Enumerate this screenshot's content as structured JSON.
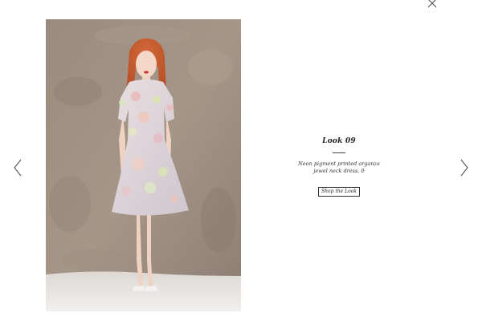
{
  "look": {
    "title": "Look 09",
    "description_line1": "Neon pigment printed organza",
    "description_line2": "jewel neck dress. 0",
    "shop_button": "Shop the Look"
  },
  "icons": {
    "close": "close-icon",
    "previous": "chevron-left-icon",
    "next": "chevron-right-icon"
  },
  "colors": {
    "background": "#ffffff",
    "text": "#222222",
    "icon": "#555555"
  }
}
